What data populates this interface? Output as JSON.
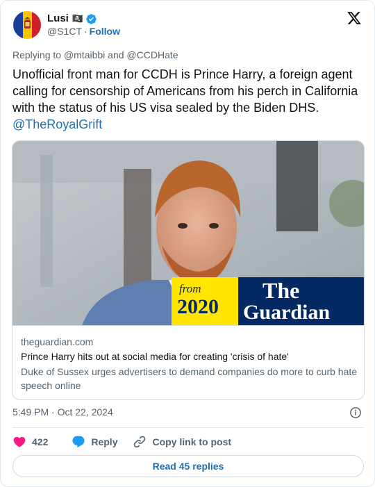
{
  "author": {
    "name": "Lusi",
    "flag_emoji": "🏴‍☠️",
    "handle": "@S1CT",
    "separator": "·",
    "follow_label": "Follow",
    "verified": true
  },
  "reply_to": {
    "prefix": "Replying to",
    "users": [
      "@mtaibbi",
      "@CCDHate"
    ],
    "joiner": "and"
  },
  "tweet": {
    "text": "Unofficial front man for CCDH is Prince Harry, a foreign agent calling for censorship of Americans from his perch in California with the status of his US visa sealed by the Biden DHS.",
    "mention": "@TheRoyalGrift"
  },
  "card": {
    "image_overlay": {
      "from_label": "from",
      "year": "2020",
      "brand_line1": "The",
      "brand_line2": "Guardian",
      "year_color": "#ffe500",
      "brand_color": "#052962"
    },
    "domain": "theguardian.com",
    "title": "Prince Harry hits out at social media for creating 'crisis of hate'",
    "description": "Duke of Sussex urges advertisers to demand companies do more to curb hate speech online"
  },
  "meta": {
    "timestamp": "5:49 PM · Oct 22, 2024"
  },
  "actions": {
    "like_count": "422",
    "reply_label": "Reply",
    "copy_label": "Copy link to post"
  },
  "footer": {
    "read_replies_label": "Read 45 replies"
  },
  "colors": {
    "link": "#1d6fb8",
    "like": "#f91880",
    "reply": "#1d9bf0",
    "muted": "#536471"
  },
  "icons": [
    "avatar-flag",
    "verified-badge-icon",
    "x-logo-icon",
    "info-icon",
    "heart-icon",
    "reply-bubble-icon",
    "link-icon"
  ]
}
